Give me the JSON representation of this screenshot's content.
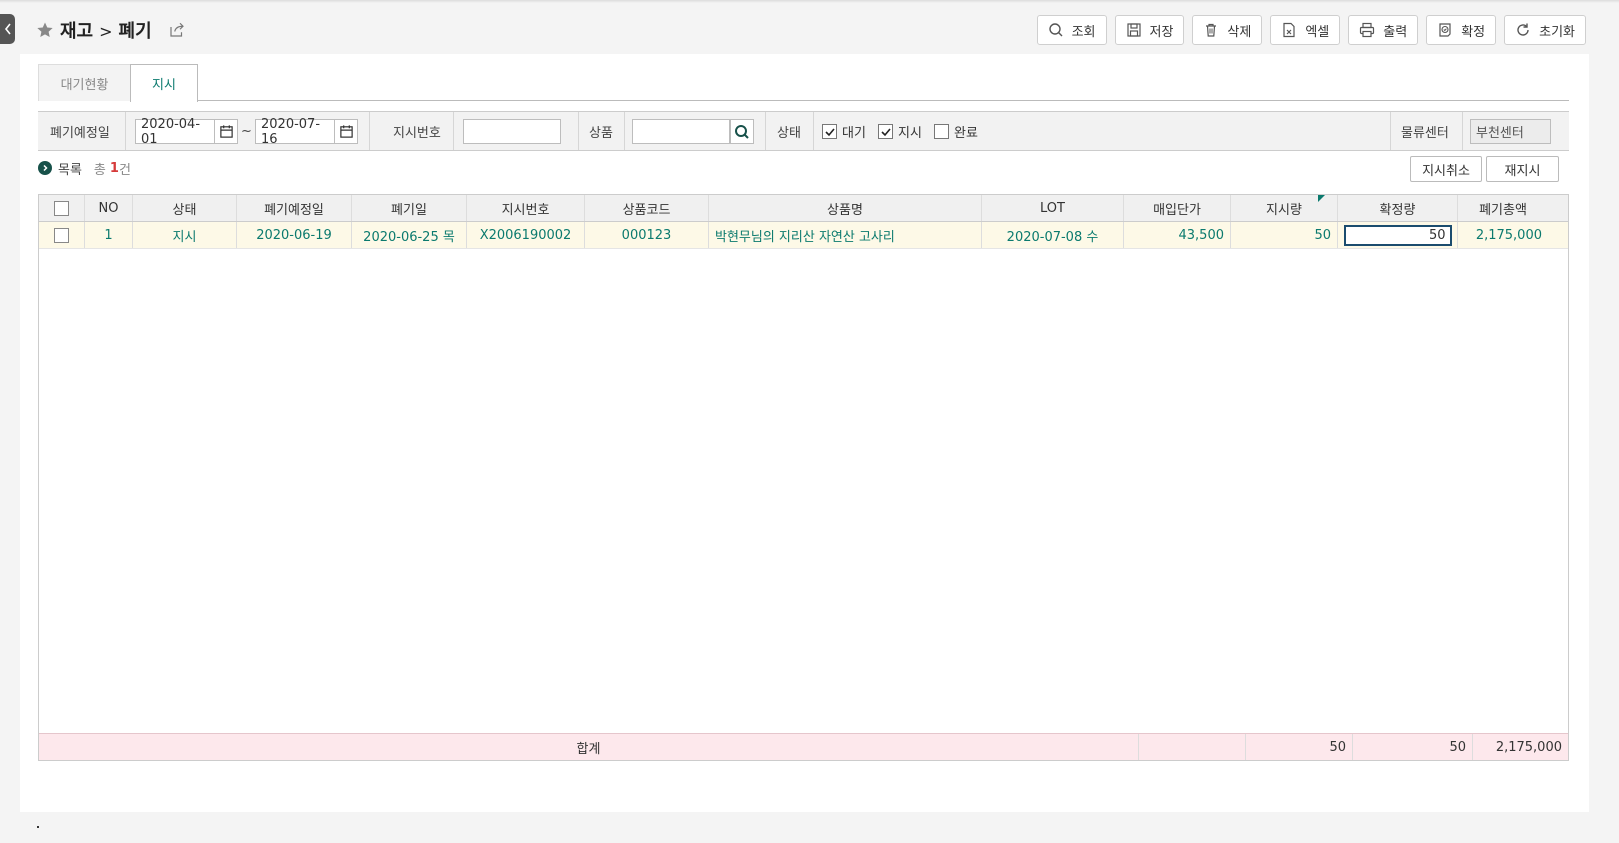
{
  "header": {
    "crumb1": "재고",
    "sep": ">",
    "crumb2": "폐기"
  },
  "toolbar": {
    "search": "조회",
    "save": "저장",
    "delete": "삭제",
    "excel": "엑셀",
    "print": "출력",
    "confirm": "확정",
    "reset": "초기화"
  },
  "tabs": [
    {
      "label": "대기현황",
      "active": false
    },
    {
      "label": "지시",
      "active": true
    }
  ],
  "filter": {
    "date_label": "폐기예정일",
    "date_from": "2020-04-01",
    "tilde": "~",
    "date_to": "2020-07-16",
    "order_label": "지시번호",
    "order_value": "",
    "product_label": "상품",
    "product_value": "",
    "status_label": "상태",
    "status_options": [
      {
        "label": "대기",
        "checked": true
      },
      {
        "label": "지시",
        "checked": true
      },
      {
        "label": "완료",
        "checked": false
      }
    ],
    "center_label": "물류센터",
    "center_value": "부천센터"
  },
  "list": {
    "title": "목록",
    "count_prefix": "총",
    "count": "1",
    "count_suffix": "건",
    "cancel_btn": "지시취소",
    "reissue_btn": "재지시"
  },
  "grid": {
    "columns": [
      "NO",
      "상태",
      "폐기예정일",
      "폐기일",
      "지시번호",
      "상품코드",
      "상품명",
      "LOT",
      "매입단가",
      "지시량",
      "확정량",
      "폐기총액"
    ],
    "rows": [
      {
        "no": "1",
        "status": "지시",
        "plan_date": "2020-06-19",
        "disposal_date": "2020-06-25 목",
        "order_no": "X2006190002",
        "product_code": "000123",
        "product_name": "박현무님의 지리산 자연산 고사리",
        "lot": "2020-07-08 수",
        "unit_price": "43,500",
        "order_qty": "50",
        "confirm_qty": "50",
        "total": "2,175,000"
      }
    ],
    "footer": {
      "label": "합계",
      "order_qty": "50",
      "confirm_qty": "50",
      "total": "2,175,000"
    }
  },
  "colors": {
    "accent": "#0b7a6e",
    "row_bg": "#fdf9e7",
    "footer_bg": "#fde8ec",
    "count_red": "#d63a3a"
  }
}
